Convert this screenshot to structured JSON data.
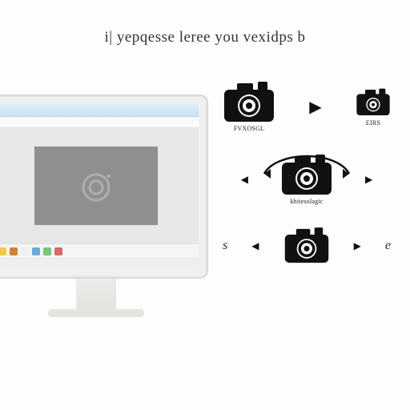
{
  "heading": "yepqesse leree you vexidps b",
  "heading_prefix": "i|",
  "canvas": {
    "icon": "camera-outline"
  },
  "swatches": [
    "#f3c94d",
    "#d08434",
    "#f0f0f0",
    "#6aaed8",
    "#7cc37c",
    "#d46a6a"
  ],
  "diagrams": {
    "row1": {
      "left_caption": "FVXOSGL",
      "right_caption": "EIRS"
    },
    "row2": {
      "caption": "khitesolagic"
    },
    "row3": {
      "left_glyph": "s",
      "right_glyph": "e"
    }
  }
}
